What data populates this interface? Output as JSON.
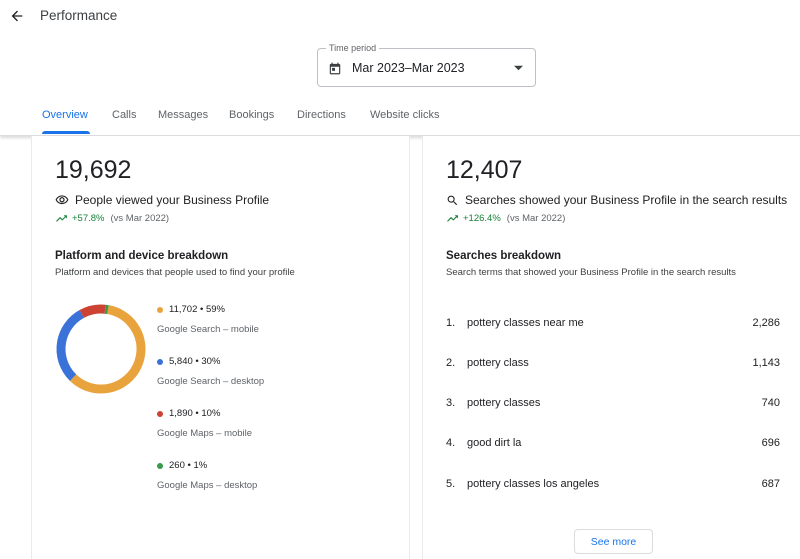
{
  "header": {
    "title": "Performance"
  },
  "time_period": {
    "label": "Time period",
    "value": "Mar 2023–Mar 2023"
  },
  "tabs": [
    {
      "label": "Overview",
      "active": true
    },
    {
      "label": "Calls"
    },
    {
      "label": "Messages"
    },
    {
      "label": "Bookings"
    },
    {
      "label": "Directions"
    },
    {
      "label": "Website clicks"
    }
  ],
  "views": {
    "total": "19,692",
    "description": "People viewed your Business Profile",
    "delta": "+57.8%",
    "comparison": "(vs Mar 2022)",
    "breakdown_title": "Platform and device breakdown",
    "breakdown_subtitle": "Platform and devices that people used to find your profile",
    "platforms": [
      {
        "stat": "11,702 • 59%",
        "label": "Google Search – mobile",
        "value": 11702,
        "percent": 59,
        "color": "#e8a33d"
      },
      {
        "stat": "5,840 • 30%",
        "label": "Google Search – desktop",
        "value": 5840,
        "percent": 30,
        "color": "#3b72d8"
      },
      {
        "stat": "1,890 • 10%",
        "label": "Google Maps – mobile",
        "value": 1890,
        "percent": 10,
        "color": "#cc4333"
      },
      {
        "stat": "260 • 1%",
        "label": "Google Maps – desktop",
        "value": 260,
        "percent": 1,
        "color": "#3a9a4c"
      }
    ]
  },
  "searches": {
    "total": "12,407",
    "description": "Searches showed your Business Profile in the search results",
    "delta": "+126.4%",
    "comparison": "(vs Mar 2022)",
    "breakdown_title": "Searches breakdown",
    "breakdown_subtitle": "Search terms that showed your Business Profile in the search results",
    "terms": [
      {
        "rank": "1.",
        "term": "pottery classes near me",
        "count": "2,286"
      },
      {
        "rank": "2.",
        "term": "pottery class",
        "count": "1,143"
      },
      {
        "rank": "3.",
        "term": "pottery classes",
        "count": "740"
      },
      {
        "rank": "4.",
        "term": "good dirt la",
        "count": "696"
      },
      {
        "rank": "5.",
        "term": "pottery classes los angeles",
        "count": "687"
      }
    ],
    "see_more_label": "See more"
  },
  "colors": {
    "accent": "#1a73e8",
    "positive": "#188038"
  }
}
